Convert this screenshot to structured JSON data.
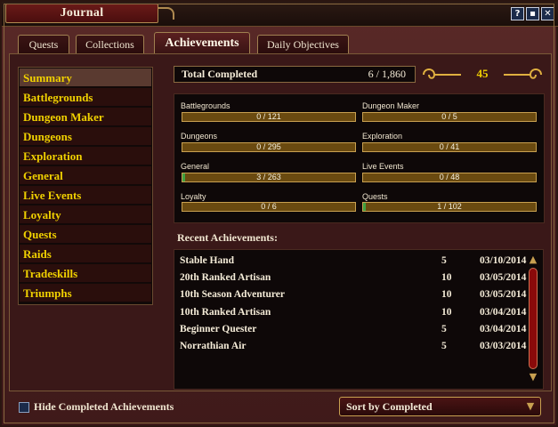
{
  "window": {
    "title": "Journal"
  },
  "titlebar": {
    "help_label": "?",
    "minimize_label": "▪",
    "close_label": "✕"
  },
  "tabs": [
    {
      "label": "Quests"
    },
    {
      "label": "Collections"
    },
    {
      "label": "Achievements"
    },
    {
      "label": "Daily Objectives"
    }
  ],
  "sidebar": {
    "items": [
      {
        "label": "Summary"
      },
      {
        "label": "Battlegrounds"
      },
      {
        "label": "Dungeon Maker"
      },
      {
        "label": "Dungeons"
      },
      {
        "label": "Exploration"
      },
      {
        "label": "General"
      },
      {
        "label": "Live Events"
      },
      {
        "label": "Loyalty"
      },
      {
        "label": "Quests"
      },
      {
        "label": "Raids"
      },
      {
        "label": "Tradeskills"
      },
      {
        "label": "Triumphs"
      }
    ]
  },
  "summary": {
    "total_label": "Total Completed",
    "total_value": "6 / 1,860",
    "points": "45"
  },
  "categories": [
    {
      "name": "Battlegrounds",
      "progress": "0 / 121",
      "fraction": 0
    },
    {
      "name": "Dungeon Maker",
      "progress": "0 / 5",
      "fraction": 0
    },
    {
      "name": "Dungeons",
      "progress": "0 / 295",
      "fraction": 0
    },
    {
      "name": "Exploration",
      "progress": "0 / 41",
      "fraction": 0
    },
    {
      "name": "General",
      "progress": "3 / 263",
      "fraction": 0.011
    },
    {
      "name": "Live Events",
      "progress": "0 / 48",
      "fraction": 0
    },
    {
      "name": "Loyalty",
      "progress": "0 / 6",
      "fraction": 0
    },
    {
      "name": "Quests",
      "progress": "1 / 102",
      "fraction": 0.01
    }
  ],
  "recent": {
    "title": "Recent Achievements:",
    "rows": [
      {
        "name": "Stable Hand",
        "points": "5",
        "date": "03/10/2014"
      },
      {
        "name": "20th Ranked Artisan",
        "points": "10",
        "date": "03/05/2014"
      },
      {
        "name": "10th Season Adventurer",
        "points": "10",
        "date": "03/05/2014"
      },
      {
        "name": "10th Ranked Artisan",
        "points": "10",
        "date": "03/04/2014"
      },
      {
        "name": "Beginner Quester",
        "points": "5",
        "date": "03/04/2014"
      },
      {
        "name": "Norrathian Air",
        "points": "5",
        "date": "03/03/2014"
      }
    ]
  },
  "scroll": {
    "up_icon": "▲",
    "down_icon": "▼"
  },
  "footer": {
    "hide_completed_label": "Hide Completed Achievements",
    "hide_completed_checked": false,
    "sort_label": "Sort by Completed",
    "sort_arrow": "▼"
  },
  "colors": {
    "accent_yellow": "#f0d000",
    "gold_border": "#c8a050",
    "bar_fill": "#6a4a10",
    "bar_progress": "#40a040"
  }
}
